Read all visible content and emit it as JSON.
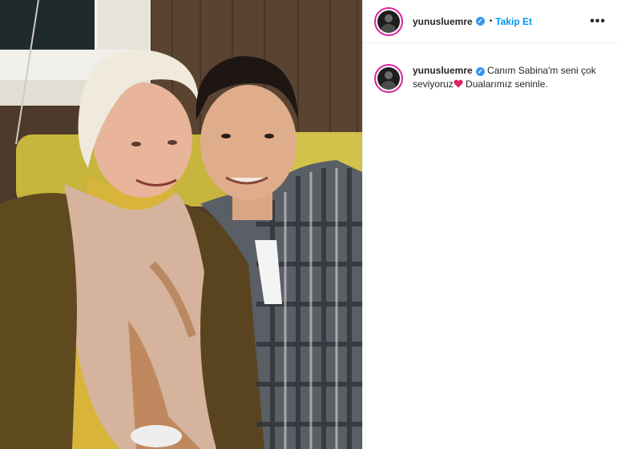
{
  "post": {
    "author": {
      "username": "yunusluemre",
      "verified": true,
      "avatar_icon": "profile-avatar"
    },
    "follow_label": "Takip Et",
    "separator": "•",
    "more_icon": "more-options-icon",
    "more_label": "•••"
  },
  "caption": {
    "username": "yunusluemre",
    "text_before_heart": "Canım Sabina'm seni çok seviyoruz",
    "heart_icon": "red-heart-emoji",
    "text_after_heart": " Dualarımız seninle."
  },
  "colors": {
    "follow_blue": "#0095f6",
    "verified_blue": "#3897f0",
    "heart_red": "#e0245e",
    "story_ring": "#d6249f"
  }
}
